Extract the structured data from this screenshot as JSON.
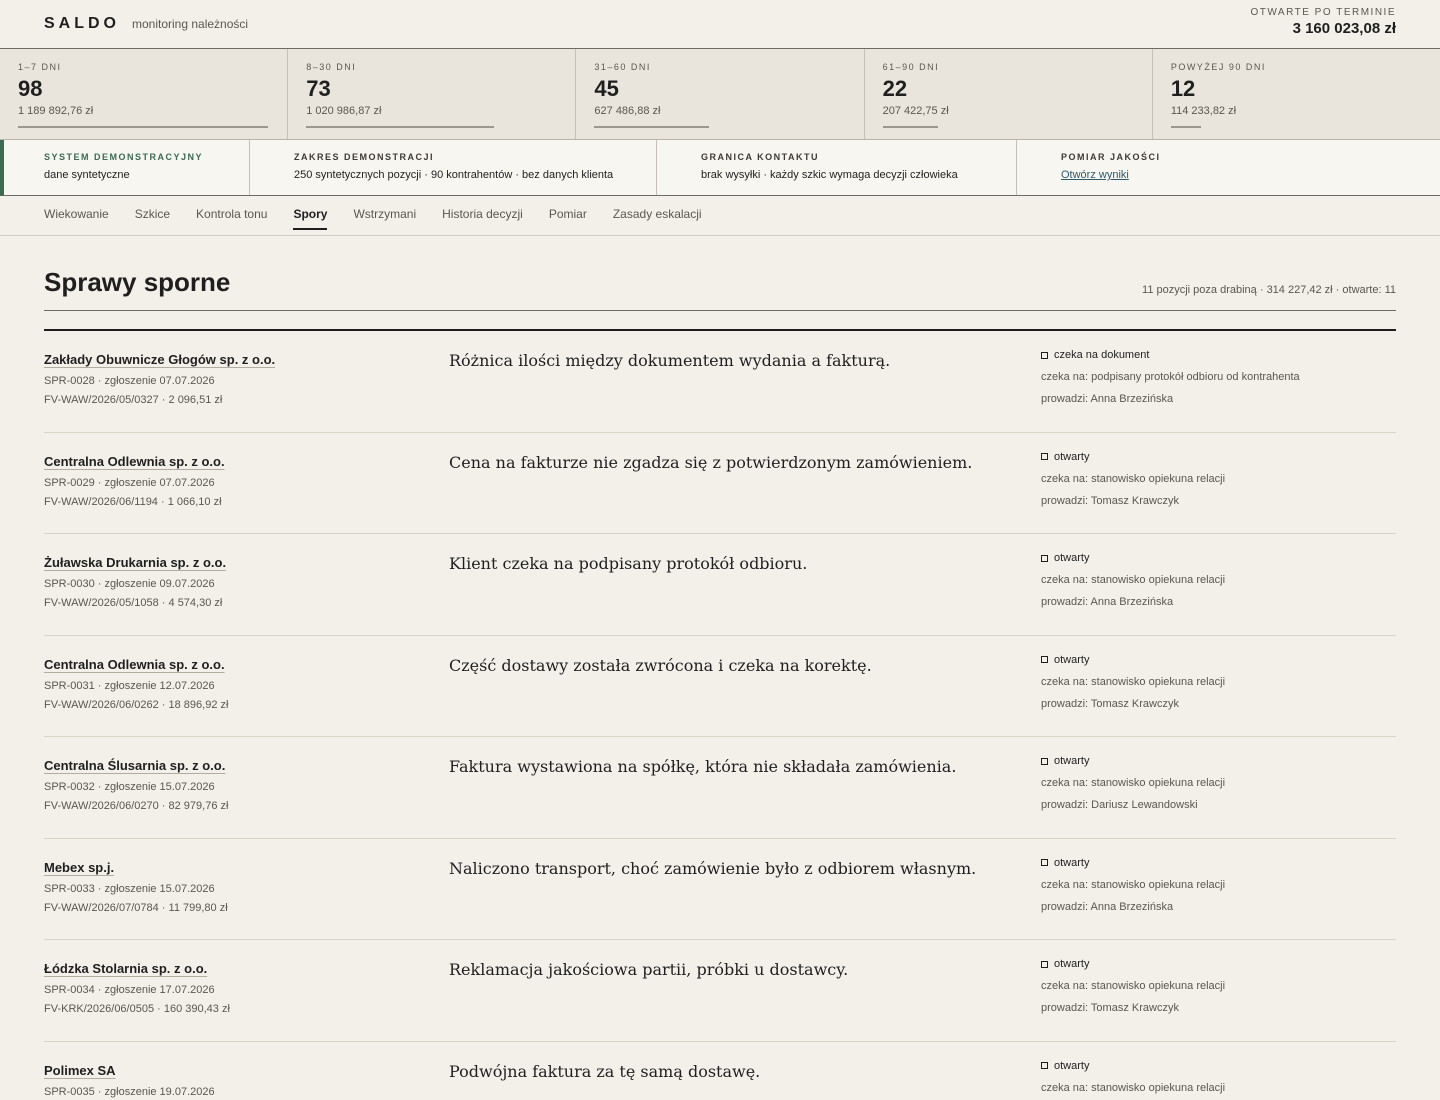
{
  "header": {
    "brand": "SALDO",
    "subtitle": "monitoring należności",
    "overdue_label": "OTWARTE PO TERMINIE",
    "overdue_value": "3 160 023,08 zł"
  },
  "buckets": [
    {
      "label": "1–7 DNI",
      "count": "98",
      "amount": "1 189 892,76 zł",
      "share": 1.0
    },
    {
      "label": "8–30 DNI",
      "count": "73",
      "amount": "1 020 986,87 zł",
      "share": 0.75
    },
    {
      "label": "31–60 DNI",
      "count": "45",
      "amount": "627 486,88 zł",
      "share": 0.46
    },
    {
      "label": "61–90 DNI",
      "count": "22",
      "amount": "207 422,75 zł",
      "share": 0.22
    },
    {
      "label": "POWYŻEJ 90 DNI",
      "count": "12",
      "amount": "114 233,82 zł",
      "share": 0.12
    }
  ],
  "info": {
    "system_label": "SYSTEM DEMONSTRACYJNY",
    "system_value": "dane syntetyczne",
    "scope_label": "ZAKRES DEMONSTRACJI",
    "scope_value": "250 syntetycznych pozycji · 90 kontrahentów · bez danych klienta",
    "contact_label": "GRANICA KONTAKTU",
    "contact_value": "brak wysyłki · każdy szkic wymaga decyzji człowieka",
    "quality_label": "POMIAR JAKOŚCI",
    "quality_link": "Otwórz wyniki",
    "accent_color": "#3c6b52"
  },
  "tabs": [
    {
      "label": "Wiekowanie",
      "active": false
    },
    {
      "label": "Szkice",
      "active": false
    },
    {
      "label": "Kontrola tonu",
      "active": false
    },
    {
      "label": "Spory",
      "active": true
    },
    {
      "label": "Wstrzymani",
      "active": false
    },
    {
      "label": "Historia decyzji",
      "active": false
    },
    {
      "label": "Pomiar",
      "active": false
    },
    {
      "label": "Zasady eskalacji",
      "active": false
    }
  ],
  "page": {
    "title": "Sprawy sporne",
    "summary": "11 pozycji poza drabiną · 314 227,42 zł · otwarte: 11"
  },
  "cases": [
    {
      "company": "Zakłady Obuwnicze Głogów sp. z o.o.",
      "meta": "SPR-0028 · zgłoszenie 07.07.2026",
      "invoice": "FV-WAW/2026/05/0327 · 2 096,51 zł",
      "description": "Różnica ilości między dokumentem wydania a fakturą.",
      "status": "czeka na dokument",
      "waits": "czeka na: podpisany protokół odbioru od kontrahenta",
      "owner": "prowadzi: Anna Brzezińska"
    },
    {
      "company": "Centralna Odlewnia sp. z o.o.",
      "meta": "SPR-0029 · zgłoszenie 07.07.2026",
      "invoice": "FV-WAW/2026/06/1194 · 1 066,10 zł",
      "description": "Cena na fakturze nie zgadza się z potwierdzonym zamówieniem.",
      "status": "otwarty",
      "waits": "czeka na: stanowisko opiekuna relacji",
      "owner": "prowadzi: Tomasz Krawczyk"
    },
    {
      "company": "Żuławska Drukarnia sp. z o.o.",
      "meta": "SPR-0030 · zgłoszenie 09.07.2026",
      "invoice": "FV-WAW/2026/05/1058 · 4 574,30 zł",
      "description": "Klient czeka na podpisany protokół odbioru.",
      "status": "otwarty",
      "waits": "czeka na: stanowisko opiekuna relacji",
      "owner": "prowadzi: Anna Brzezińska"
    },
    {
      "company": "Centralna Odlewnia sp. z o.o.",
      "meta": "SPR-0031 · zgłoszenie 12.07.2026",
      "invoice": "FV-WAW/2026/06/0262 · 18 896,92 zł",
      "description": "Część dostawy została zwrócona i czeka na korektę.",
      "status": "otwarty",
      "waits": "czeka na: stanowisko opiekuna relacji",
      "owner": "prowadzi: Tomasz Krawczyk"
    },
    {
      "company": "Centralna Ślusarnia sp. z o.o.",
      "meta": "SPR-0032 · zgłoszenie 15.07.2026",
      "invoice": "FV-WAW/2026/06/0270 · 82 979,76 zł",
      "description": "Faktura wystawiona na spółkę, która nie składała zamówienia.",
      "status": "otwarty",
      "waits": "czeka na: stanowisko opiekuna relacji",
      "owner": "prowadzi: Dariusz Lewandowski"
    },
    {
      "company": "Mebex sp.j.",
      "meta": "SPR-0033 · zgłoszenie 15.07.2026",
      "invoice": "FV-WAW/2026/07/0784 · 11 799,80 zł",
      "description": "Naliczono transport, choć zamówienie było z odbiorem własnym.",
      "status": "otwarty",
      "waits": "czeka na: stanowisko opiekuna relacji",
      "owner": "prowadzi: Anna Brzezińska"
    },
    {
      "company": "Łódzka Stolarnia sp. z o.o.",
      "meta": "SPR-0034 · zgłoszenie 17.07.2026",
      "invoice": "FV-KRK/2026/06/0505 · 160 390,43 zł",
      "description": "Reklamacja jakościowa partii, próbki u dostawcy.",
      "status": "otwarty",
      "waits": "czeka na: stanowisko opiekuna relacji",
      "owner": "prowadzi: Tomasz Krawczyk"
    },
    {
      "company": "Polimex SA",
      "meta": "SPR-0035 · zgłoszenie 19.07.2026",
      "invoice": "",
      "description": "Podwójna faktura za tę samą dostawę.",
      "status": "otwarty",
      "waits": "czeka na: stanowisko opiekuna relacji",
      "owner": ""
    }
  ]
}
